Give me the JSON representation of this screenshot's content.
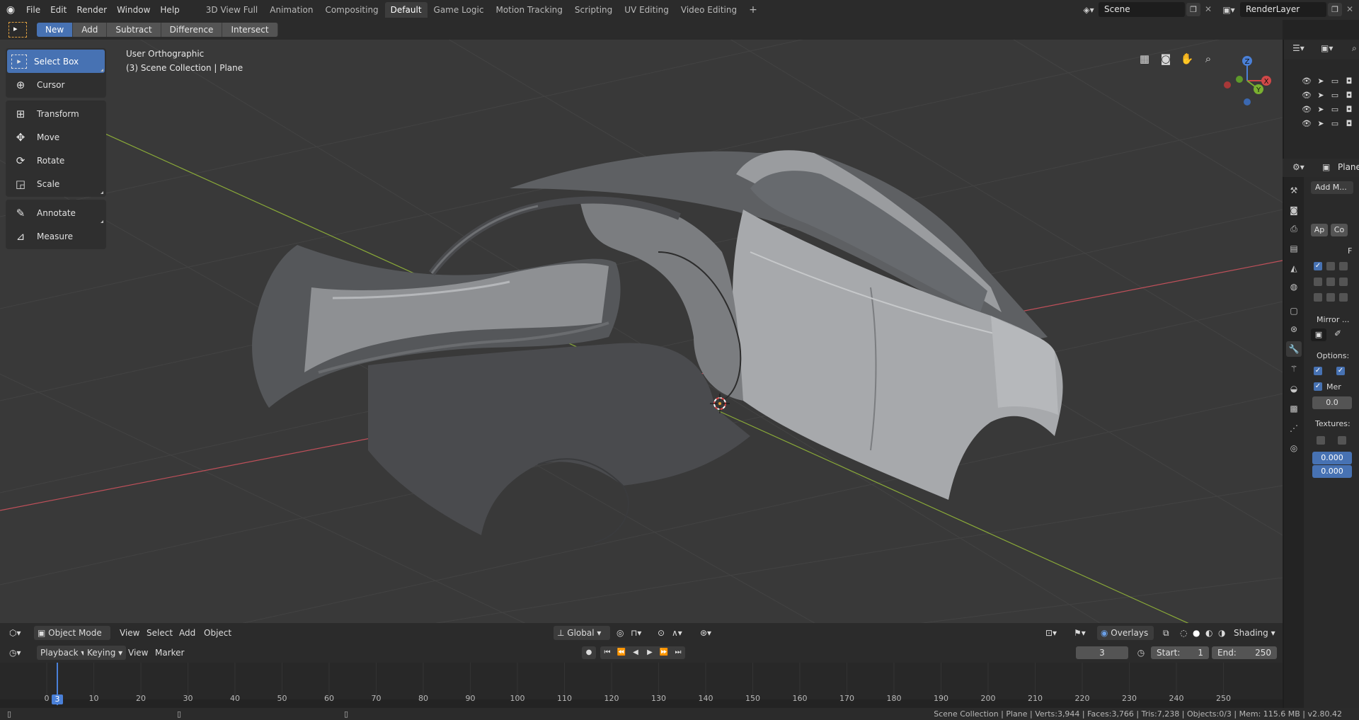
{
  "topbar": {
    "menus": [
      "File",
      "Edit",
      "Render",
      "Window",
      "Help"
    ],
    "workspace_tabs": [
      "3D View Full",
      "Animation",
      "Compositing",
      "Default",
      "Game Logic",
      "Motion Tracking",
      "Scripting",
      "UV Editing",
      "Video Editing"
    ],
    "active_tab": "Default",
    "add_tab": "+",
    "scene": "Scene",
    "render_layer": "RenderLayer"
  },
  "toolrow": {
    "buttons": [
      "New",
      "Add",
      "Subtract",
      "Difference",
      "Intersect"
    ],
    "active": "New"
  },
  "viewport": {
    "view_name": "User Orthographic",
    "collection_info": "(3) Scene Collection | Plane",
    "gizmo": {
      "x": "X",
      "y": "Y",
      "z": "Z"
    }
  },
  "toolshelf": {
    "groups": [
      [
        {
          "label": "Select Box",
          "icon": "select-box-icon",
          "active": true
        },
        {
          "label": "Cursor",
          "icon": "cursor-icon"
        }
      ],
      [
        {
          "label": "Transform",
          "icon": "transform-icon"
        },
        {
          "label": "Move",
          "icon": "move-icon"
        },
        {
          "label": "Rotate",
          "icon": "rotate-icon"
        },
        {
          "label": "Scale",
          "icon": "scale-icon"
        }
      ],
      [
        {
          "label": "Annotate",
          "icon": "annotate-icon"
        },
        {
          "label": "Measure",
          "icon": "measure-icon"
        }
      ]
    ]
  },
  "vp_footer": {
    "mode": "Object Mode",
    "menus": [
      "View",
      "Select",
      "Add",
      "Object"
    ],
    "orientation": "Global",
    "overlays": "Overlays",
    "shading": "Shading"
  },
  "timeline": {
    "menus": [
      "Playback",
      "Keying",
      "View",
      "Marker"
    ],
    "current_frame": "3",
    "start_label": "Start:",
    "start": "1",
    "end_label": "End:",
    "end": "250",
    "ruler": [
      "0",
      "10",
      "20",
      "30",
      "40",
      "50",
      "60",
      "70",
      "80",
      "90",
      "100",
      "110",
      "120",
      "130",
      "140",
      "150",
      "160",
      "170",
      "180",
      "190",
      "200",
      "210",
      "220",
      "230",
      "240",
      "250"
    ],
    "playhead": "3"
  },
  "status": {
    "text": "Scene Collection | Plane | Verts:3,944 | Faces:3,766 | Tris:7,238 | Objects:0/3 | Mem: 115.6 MB | v2.80.42"
  },
  "properties": {
    "object_name": "Plane",
    "add_modifier": "Add M...",
    "apply": "Ap",
    "copy": "Co",
    "f_label": "F",
    "mirror": "Mirror ...",
    "options": "Options:",
    "merge": "Mer",
    "merge_value": "0.0",
    "textures": "Textures:",
    "tex_u": "0.000",
    "tex_v": "0.000"
  },
  "colors": {
    "accent": "#4772b3",
    "viewport_bg": "#393939",
    "axis_x": "#c0505a",
    "axis_y": "#8aaa38"
  }
}
